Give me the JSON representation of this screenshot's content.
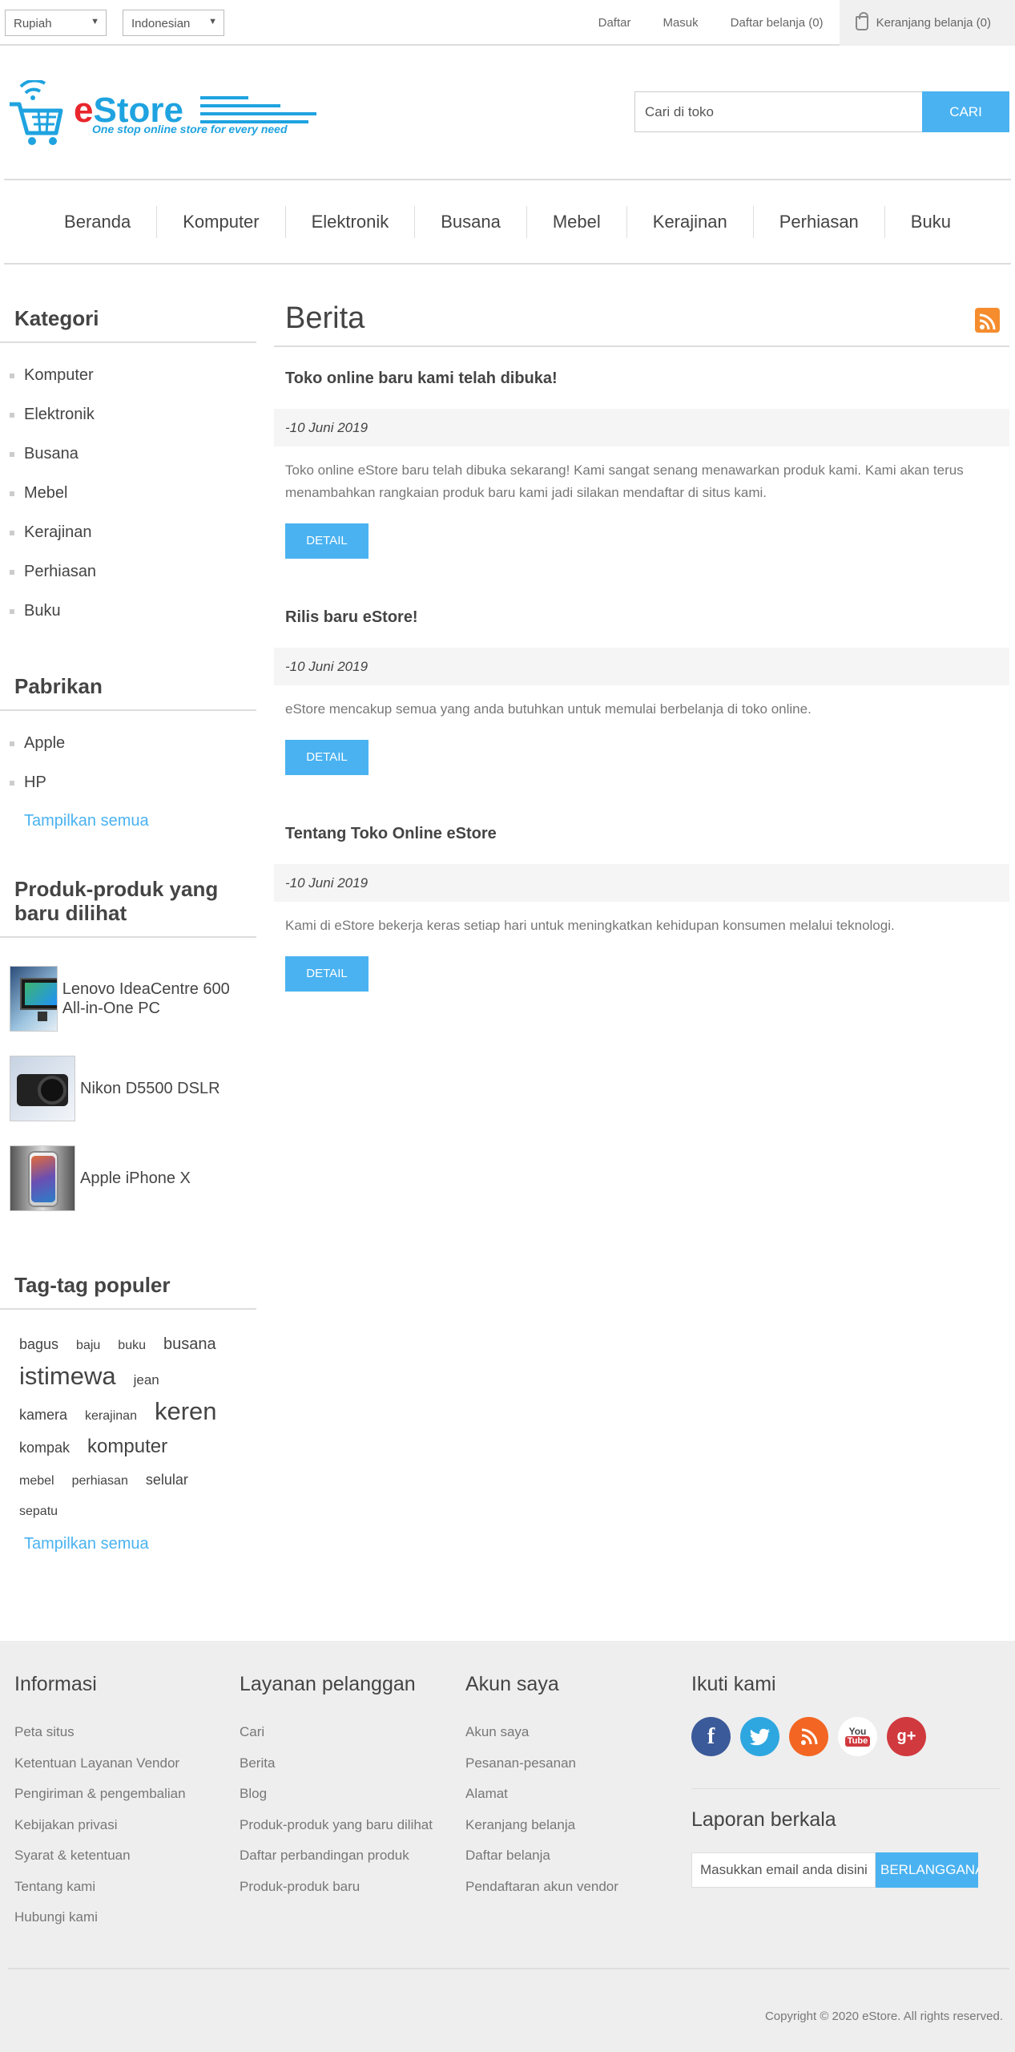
{
  "header": {
    "currency": "Rupiah",
    "language": "Indonesian",
    "links": [
      "Daftar",
      "Masuk",
      "Daftar belanja (0)"
    ],
    "cart_label": "Keranjang belanja (0)"
  },
  "logo": {
    "brand": "eStore",
    "tagline": "One stop online store for every need"
  },
  "search": {
    "placeholder": "Cari di toko",
    "button": "CARI"
  },
  "menu": [
    "Beranda",
    "Komputer",
    "Elektronik",
    "Busana",
    "Mebel",
    "Kerajinan",
    "Perhiasan",
    "Buku"
  ],
  "sidebar": {
    "categories_title": "Kategori",
    "categories": [
      "Komputer",
      "Elektronik",
      "Busana",
      "Mebel",
      "Kerajinan",
      "Perhiasan",
      "Buku"
    ],
    "manufacturers_title": "Pabrikan",
    "manufacturers": [
      "Apple",
      "HP"
    ],
    "manufacturers_showall": "Tampilkan semua",
    "recent_title": "Produk-produk yang baru dilihat",
    "recent": [
      "Lenovo IdeaCentre 600 All-in-One PC",
      "Nikon D5500 DSLR",
      "Apple iPhone X"
    ],
    "tags_title": "Tag-tag populer",
    "tags": [
      {
        "name": "bagus",
        "size": 18
      },
      {
        "name": "baju",
        "size": 16
      },
      {
        "name": "buku",
        "size": 16
      },
      {
        "name": "busana",
        "size": 20
      },
      {
        "name": "istimewa",
        "size": 31
      },
      {
        "name": "jean",
        "size": 17
      },
      {
        "name": "kamera",
        "size": 18
      },
      {
        "name": "kerajinan",
        "size": 16
      },
      {
        "name": "keren",
        "size": 31
      },
      {
        "name": "kompak",
        "size": 18
      },
      {
        "name": "komputer",
        "size": 24
      },
      {
        "name": "mebel",
        "size": 16
      },
      {
        "name": "perhiasan",
        "size": 16
      },
      {
        "name": "selular",
        "size": 18
      },
      {
        "name": "sepatu",
        "size": 16
      }
    ],
    "tags_showall": "Tampilkan semua"
  },
  "main": {
    "title": "Berita",
    "news": [
      {
        "title": "Toko online baru kami telah dibuka!",
        "date": "-10 Juni 2019",
        "body": "Toko online eStore baru telah dibuka sekarang! Kami sangat senang menawarkan produk kami. Kami akan terus menambahkan rangkaian produk baru kami jadi silakan mendaftar di situs kami.",
        "button": "DETAIL"
      },
      {
        "title": "Rilis baru eStore!",
        "date": "-10 Juni 2019",
        "body": "eStore mencakup semua yang anda butuhkan untuk memulai berbelanja di toko online.",
        "button": "DETAIL"
      },
      {
        "title": "Tentang Toko Online eStore",
        "date": "-10 Juni 2019",
        "body": "Kami di eStore bekerja keras setiap hari untuk meningkatkan kehidupan konsumen melalui teknologi.",
        "button": "DETAIL"
      }
    ]
  },
  "footer": {
    "info_title": "Informasi",
    "info": [
      "Peta situs",
      "Ketentuan Layanan Vendor",
      "Pengiriman & pengembalian",
      "Kebijakan privasi",
      "Syarat & ketentuan",
      "Tentang kami",
      "Hubungi kami"
    ],
    "service_title": "Layanan pelanggan",
    "service": [
      "Cari",
      "Berita",
      "Blog",
      "Produk-produk yang baru dilihat",
      "Daftar perbandingan produk",
      "Produk-produk baru"
    ],
    "account_title": "Akun saya",
    "account": [
      "Akun saya",
      "Pesanan-pesanan",
      "Alamat",
      "Keranjang belanja",
      "Daftar belanja",
      "Pendaftaran akun vendor"
    ],
    "follow_title": "Ikuti kami",
    "social": [
      {
        "name": "facebook-icon",
        "glyph": "f",
        "color": "#3b5a9a"
      },
      {
        "name": "twitter-icon",
        "glyph": "t",
        "color": "#2ea7e0"
      },
      {
        "name": "rss-icon",
        "glyph": "r",
        "color": "#f26522"
      },
      {
        "name": "youtube-icon",
        "glyph": "You Tube",
        "color": "#ffffff"
      },
      {
        "name": "google-plus-icon",
        "glyph": "g+",
        "color": "#d0393e"
      }
    ],
    "newsletter_title": "Laporan berkala",
    "newsletter_placeholder": "Masukkan email anda disini...",
    "newsletter_button": "BERLANGGANAN",
    "copyright": "Copyright © 2020 eStore. All rights reserved."
  },
  "colors": {
    "accent": "#4ab2f1",
    "rss": "#f58d2e",
    "brand_red": "#e8262c"
  }
}
